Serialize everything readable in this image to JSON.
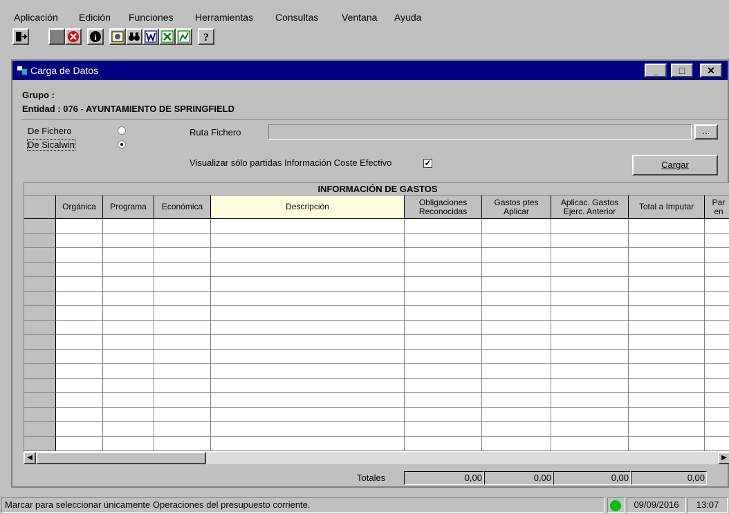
{
  "menu": [
    "Aplicación",
    "Edición",
    "Funciones",
    "Herramientas",
    "Consultas",
    "Ventana",
    "Ayuda"
  ],
  "toolbar": {
    "icons": [
      "exit-icon",
      "stop-icon",
      "close-red-icon",
      "info-icon",
      "image-icon",
      "binoculars-icon",
      "word-icon",
      "excel-icon",
      "chart-icon",
      "help-icon"
    ],
    "info_glyph": "i",
    "help_glyph": "?"
  },
  "window": {
    "title": "Carga de Datos",
    "minimize": "_",
    "maximize": "□",
    "close": "✕"
  },
  "header": {
    "grupo": "Grupo :",
    "entidad": "Entidad : 076 - AYUNTAMIENTO DE SPRINGFIELD"
  },
  "options": {
    "de_fichero": "De Fichero",
    "de_sicalwin": "De Sicalwin",
    "selected": "De Sicalwin",
    "ruta_label": "Ruta Fichero",
    "ruta_value": "",
    "browse": "...",
    "visualizar_label": "Visualizar sólo partidas Información Coste Efectivo",
    "visualizar_checked": true,
    "check_glyph": "✓",
    "cargar": "Cargar"
  },
  "grid": {
    "title": "INFORMACIÓN DE GASTOS",
    "columns": [
      "Orgánica",
      "Programa",
      "Económica",
      "Descripción",
      "Obligaciones Reconocidas",
      "Gastos ptes Aplicar",
      "Aplicac. Gastos Ejerc. Anterior",
      "Total a Imputar",
      "Par en"
    ],
    "row_count": 16
  },
  "totals": {
    "label": "Totales",
    "values": [
      "0,00",
      "0,00",
      "0,00",
      "0,00"
    ]
  },
  "status": {
    "message": "Marcar para seleccionar únicamente Operaciones del presupuesto corriente.",
    "date": "09/09/2016",
    "time": "13:07",
    "indicator_color": "#00c000"
  },
  "colors": {
    "title_bar": "#000080",
    "face": "#c0c0c0",
    "highlight_column": "#fffde0"
  }
}
